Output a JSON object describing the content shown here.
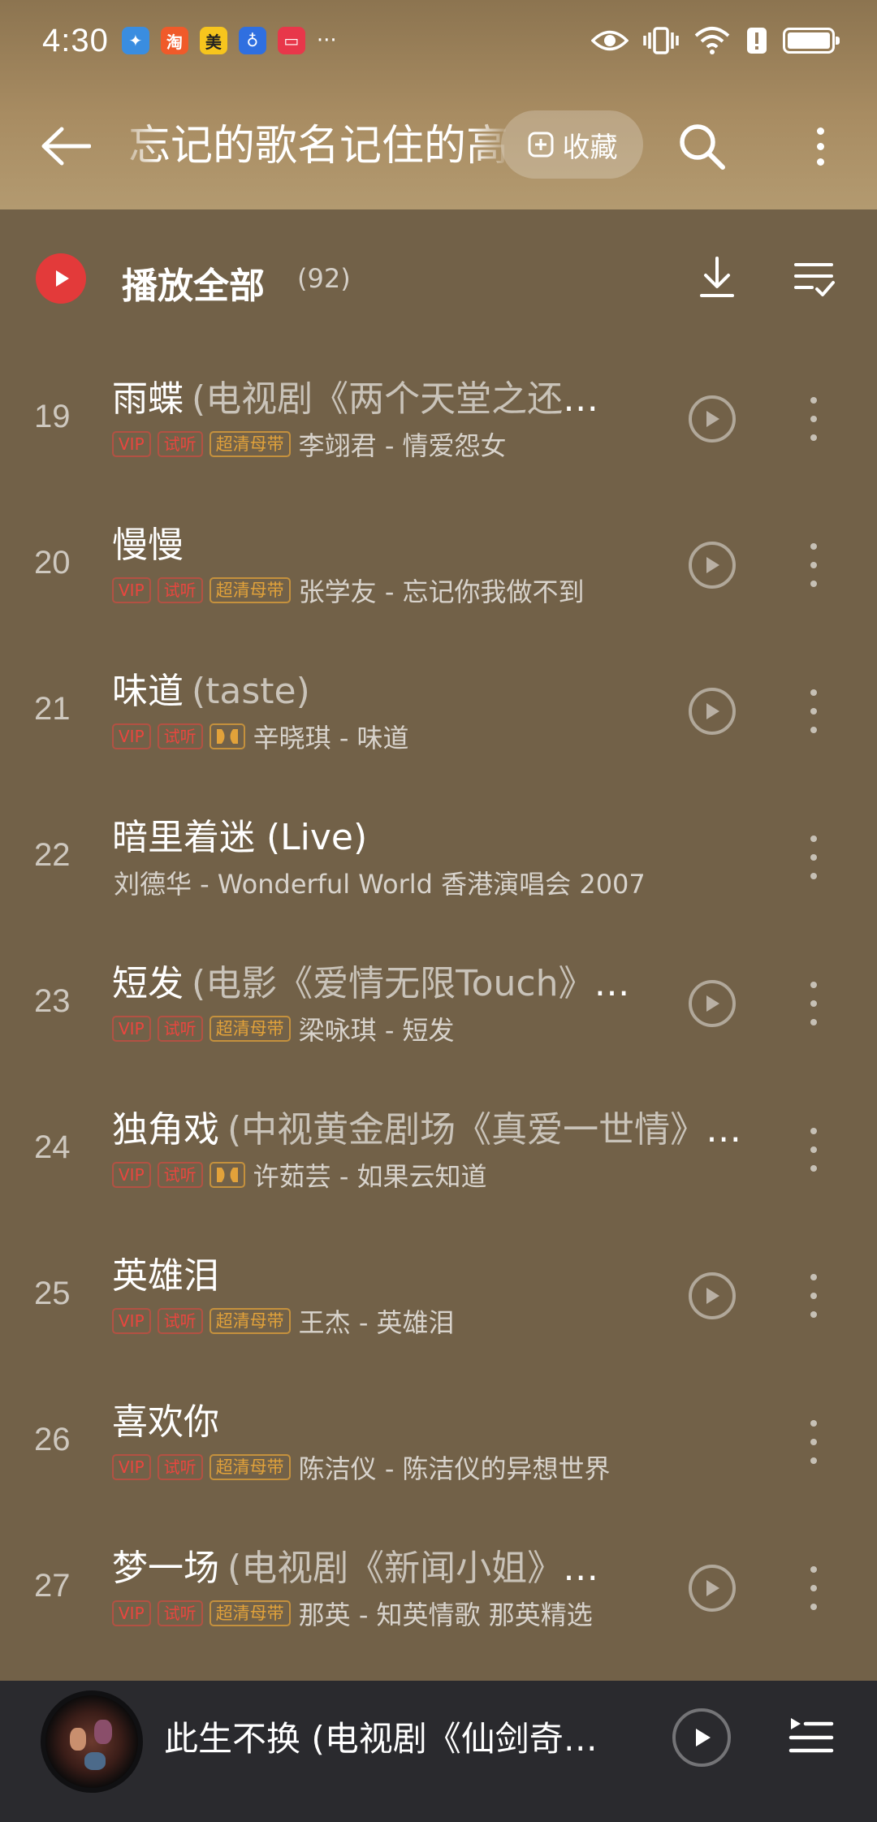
{
  "status_bar": {
    "time": "4:30",
    "more_notifications": "···",
    "notifications": [
      {
        "name": "app-notif-blue-bird",
        "color": "#3a8de0",
        "glyph": "✦"
      },
      {
        "name": "app-notif-taobao",
        "color": "#f05a2a",
        "glyph": "淘"
      },
      {
        "name": "app-notif-meituan",
        "color": "#f7c51d",
        "glyph": "美"
      },
      {
        "name": "app-notif-bulb",
        "color": "#2f6fe0",
        "glyph": "♁"
      },
      {
        "name": "app-notif-red-book",
        "color": "#e8374a",
        "glyph": "▭"
      }
    ]
  },
  "nav": {
    "title": "忘记的歌名记住的高潮",
    "collect_label": "收藏"
  },
  "play_all": {
    "label": "播放全部",
    "count": "(92)"
  },
  "tags": {
    "vip": "VIP",
    "trial": "试听",
    "hq": "超清母带"
  },
  "songs": [
    {
      "index": "19",
      "title": "雨蝶",
      "sub": "(电视剧《两个天堂之还珠格格》主题曲)",
      "quality": "hq",
      "meta": "李翊君 - 情爱怨女",
      "mv": true,
      "tags": true
    },
    {
      "index": "20",
      "title": "慢慢",
      "sub": "",
      "quality": "hq",
      "meta": "张学友 - 忘记你我做不到",
      "mv": true,
      "tags": true
    },
    {
      "index": "21",
      "title": "味道",
      "sub": "(taste)",
      "quality": "dolby",
      "meta": "辛晓琪 - 味道",
      "mv": true,
      "tags": true
    },
    {
      "index": "22",
      "title": "暗里着迷 (Live)",
      "sub": "",
      "quality": "none",
      "meta": "刘德华 - Wonderful World 香港演唱会 2007",
      "mv": false,
      "tags": false
    },
    {
      "index": "23",
      "title": "短发",
      "sub": "(电影《爱情无限Touch》主题曲)",
      "quality": "hq",
      "meta": "梁咏琪 - 短发",
      "mv": true,
      "tags": true
    },
    {
      "index": "24",
      "title": "独角戏",
      "sub": "(中视黄金剧场《真爱一世情》主题曲)",
      "quality": "dolby",
      "meta": "许茹芸 - 如果云知道",
      "mv": false,
      "tags": true
    },
    {
      "index": "25",
      "title": "英雄泪",
      "sub": "",
      "quality": "hq",
      "meta": "王杰 - 英雄泪",
      "mv": true,
      "tags": true
    },
    {
      "index": "26",
      "title": "喜欢你",
      "sub": "",
      "quality": "hq",
      "meta": "陈洁仪 - 陈洁仪的异想世界",
      "mv": false,
      "tags": true
    },
    {
      "index": "27",
      "title": "梦一场",
      "sub": "(电视剧《新闻小姐》插曲)",
      "quality": "hq",
      "meta": "那英 - 知英情歌 那英精选",
      "mv": true,
      "tags": true
    }
  ],
  "mini_player": {
    "title": "此生不换 (电视剧《仙剑奇侠传三》片尾曲)"
  },
  "colors": {
    "accent_red": "#e33a3a",
    "background": "#726148",
    "tag_gold": "#e2a23a",
    "tag_red": "#e9463f"
  }
}
